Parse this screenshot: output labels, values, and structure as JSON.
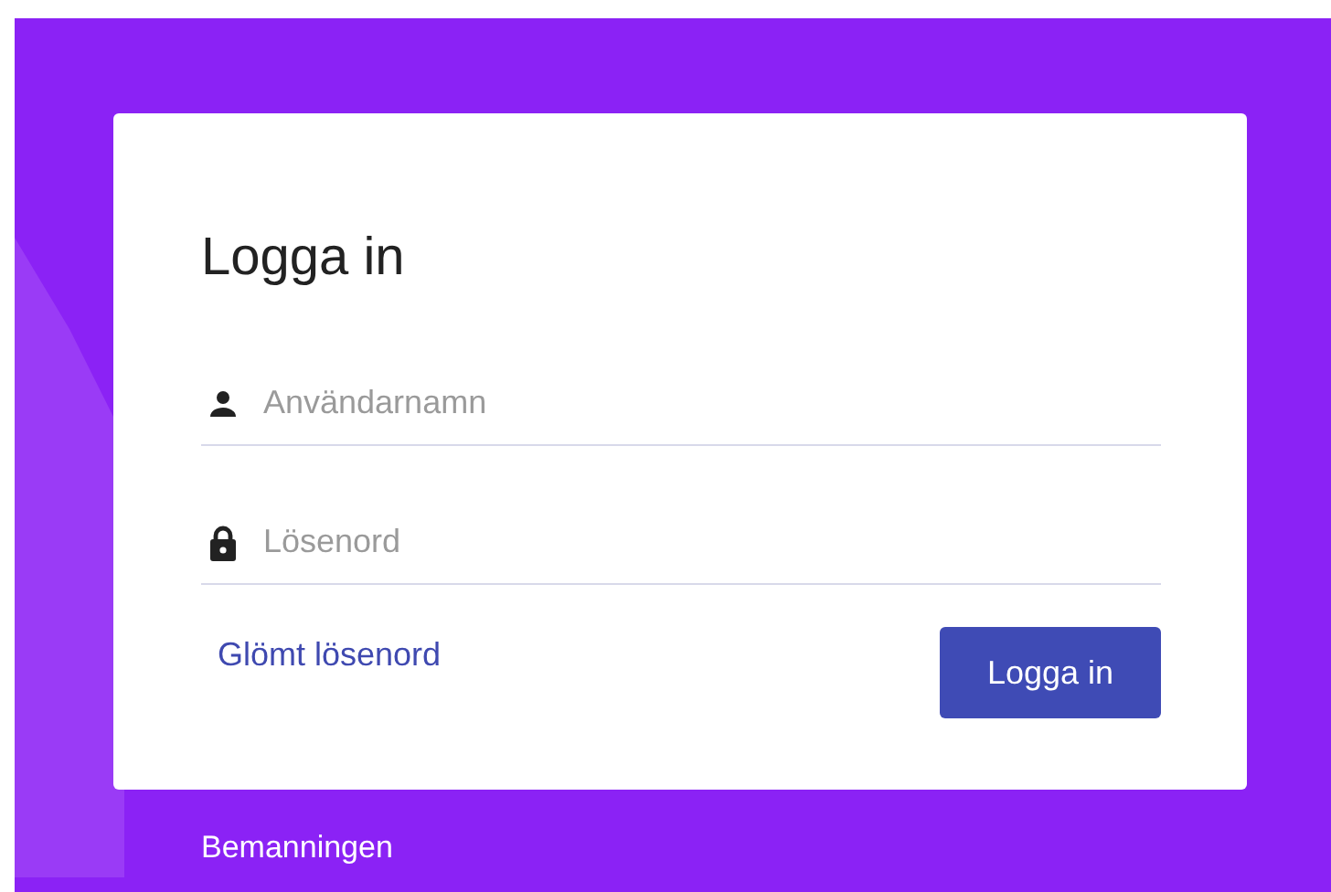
{
  "card": {
    "title": "Logga in",
    "fields": [
      {
        "kind": "user",
        "placeholder": "Användarnamn"
      },
      {
        "kind": "password",
        "placeholder": "Lösenord"
      }
    ],
    "forgot_link": "Glömt lösenord",
    "submit_button": "Logga in"
  },
  "footer": "Bemanningen"
}
